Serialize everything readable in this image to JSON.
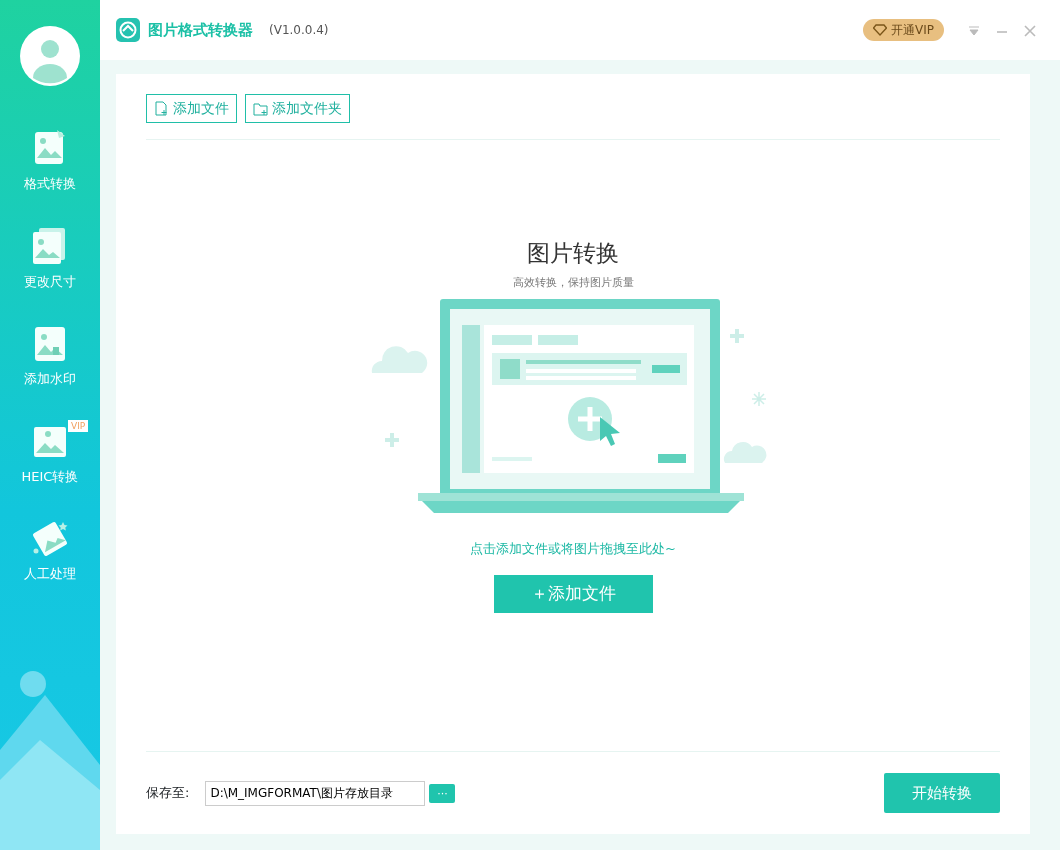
{
  "app": {
    "title": "图片格式转换器",
    "version": "(V1.0.0.4)",
    "vip_button": "开通VIP"
  },
  "sidebar": {
    "items": [
      {
        "label": "格式转换",
        "kind": "convert"
      },
      {
        "label": "更改尺寸",
        "kind": "resize"
      },
      {
        "label": "添加水印",
        "kind": "watermark"
      },
      {
        "label": "HEIC转换",
        "kind": "heic",
        "badge": "VIP"
      },
      {
        "label": "人工处理",
        "kind": "manual"
      }
    ]
  },
  "toolbar": {
    "buttons": [
      {
        "label": "添加文件",
        "kind": "file"
      },
      {
        "label": "添加文件夹",
        "kind": "folder"
      }
    ]
  },
  "drop_zone": {
    "title": "图片转换",
    "subtitle": "高效转换，保持图片质量",
    "hint": "点击添加文件或将图片拖拽至此处~",
    "button": "＋添加文件"
  },
  "footer": {
    "label": "保存至:",
    "path": "D:\\M_IMGFORMAT\\图片存放目录",
    "browse": "···",
    "start": "开始转换"
  }
}
